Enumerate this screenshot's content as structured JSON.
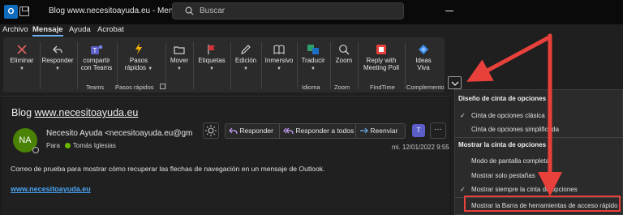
{
  "titlebar": {
    "app_icon_letter": "O",
    "title": "Blog www.necesitoayuda.eu - Mensaje (HTML)",
    "search_placeholder": "Buscar"
  },
  "tabs": [
    {
      "label": "Archivo",
      "active": false
    },
    {
      "label": "Mensaje",
      "active": true
    },
    {
      "label": "Ayuda",
      "active": false
    },
    {
      "label": "Acrobat",
      "active": false
    }
  ],
  "ribbon": {
    "eliminar": "Eliminar",
    "responder": "Responder",
    "compartir_1": "compartir",
    "compartir_2": "con Teams",
    "pasos_1": "Pasos",
    "pasos_2": "rápidos",
    "mover": "Mover",
    "etiquetas": "Etiquetas",
    "edicion": "Edición",
    "inmersivo": "Inmersivo",
    "traducir": "Traducir",
    "zoom": "Zoom",
    "reply_1": "Reply with",
    "reply_2": "Meeting Poll",
    "ideas_1": "Ideas",
    "ideas_2": "Viva",
    "groups": {
      "teams": "Teams",
      "pasos": "Pasos rápidos",
      "idioma": "Idioma",
      "zoom": "Zoom",
      "findtime": "FindTime",
      "complemento": "Complemento"
    },
    "colors": {
      "eliminar": "#e06060",
      "pasos": "#f7b500",
      "etiquetas": "#d13438",
      "teams": "#5b5fc7",
      "findtime": "#e8403a",
      "ideas": "#3b8beb",
      "traducir": "#2e9e6a"
    }
  },
  "message": {
    "subject_prefix": "Blog ",
    "subject_link": "www.necesitoayuda.eu",
    "avatar_initials": "NA",
    "sender": "Necesito Ayuda <necesitoayuda.eu@gm",
    "to_label": "Para",
    "to_name": "Tomás Iglesias",
    "date": "mi. 12/01/2022 9:55",
    "actions": {
      "reply": "Responder",
      "reply_all": "Responder a todos",
      "forward": "Reenviar"
    },
    "body": "Correo de prueba para mostrar cómo recuperar las flechas de navegación en un mensaje de Outlook.",
    "body_link": "www.necesitoayuda.eu"
  },
  "menu": {
    "heading_1": "Diseño de cinta de opciones",
    "classic": "Cinta de opciones clásica",
    "simplified": "Cinta de opciones simplificada",
    "heading_2": "Mostrar la cinta de opciones",
    "fullscreen": "Modo de pantalla completa",
    "tabs_only": "Mostrar solo pestañas",
    "always": "Mostrar siempre la cinta de opciones",
    "qat": "Mostrar la Barra de herramientas de acceso rápido",
    "check": "✓"
  },
  "annotation_color": "#e8403a"
}
